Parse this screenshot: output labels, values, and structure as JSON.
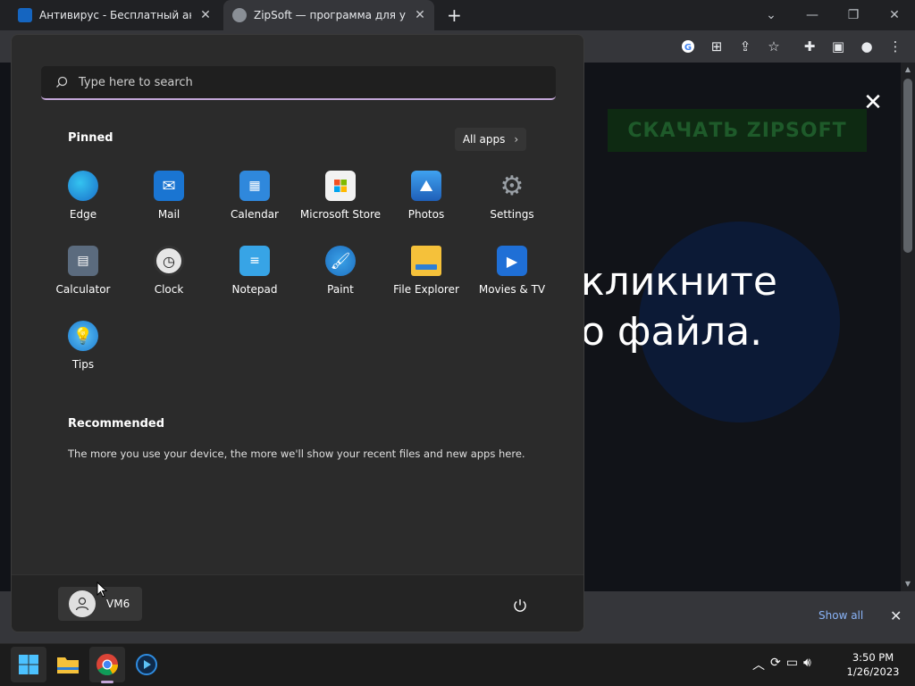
{
  "browser": {
    "tabs": [
      {
        "title": "Антивирус - Бесплатный антивирус"
      },
      {
        "title": "ZipSoft — программа для установки"
      }
    ],
    "new_tab": "+",
    "toolbar_icons": [
      "google-icon",
      "translate-icon",
      "share-icon",
      "bookmark-star-icon",
      "extensions-icon",
      "sidepanel-icon",
      "profile-icon",
      "menu-icon"
    ]
  },
  "webpage": {
    "download_button": "СКАЧАТЬ ZIPSOFT",
    "line1": "кликните",
    "line2": "о файла.",
    "close": "✕"
  },
  "download_shelf": {
    "show_all": "Show all"
  },
  "start_menu": {
    "search_placeholder": "Type here to search",
    "pinned_heading": "Pinned",
    "all_apps": "All apps",
    "apps": [
      {
        "name": "Edge",
        "icon": "edge-icon",
        "color": "#1fa0e2"
      },
      {
        "name": "Mail",
        "icon": "mail-icon",
        "color": "#1a75d2"
      },
      {
        "name": "Calendar",
        "icon": "calendar-icon",
        "color": "#2f88dc"
      },
      {
        "name": "Microsoft Store",
        "icon": "store-icon",
        "color": "#f2f2f2"
      },
      {
        "name": "Photos",
        "icon": "photos-icon",
        "color": "#2a8ad6"
      },
      {
        "name": "Settings",
        "icon": "settings-icon",
        "color": "#7a7a7a"
      },
      {
        "name": "Calculator",
        "icon": "calculator-icon",
        "color": "#5b6b7e"
      },
      {
        "name": "Clock",
        "icon": "clock-icon",
        "color": "#e6e6e6"
      },
      {
        "name": "Notepad",
        "icon": "notepad-icon",
        "color": "#37a4e6"
      },
      {
        "name": "Paint",
        "icon": "paint-icon",
        "color": "#3aa2e8"
      },
      {
        "name": "File Explorer",
        "icon": "folder-icon",
        "color": "#f5c13a"
      },
      {
        "name": "Movies & TV",
        "icon": "movies-icon",
        "color": "#1f6fd6"
      },
      {
        "name": "Tips",
        "icon": "tips-icon",
        "color": "#2aa0e8"
      }
    ],
    "recommended_heading": "Recommended",
    "recommended_text": "The more you use your device, the more we'll show your recent files and new apps here.",
    "user_name": "VM6"
  },
  "taskbar": {
    "apps": [
      "windows-start-icon",
      "file-explorer-icon",
      "chrome-icon",
      "media-player-icon"
    ],
    "time": "3:50 PM",
    "date": "1/26/2023"
  },
  "colors": {
    "accent": "#c3a6d8",
    "link": "#8ab4f8"
  }
}
